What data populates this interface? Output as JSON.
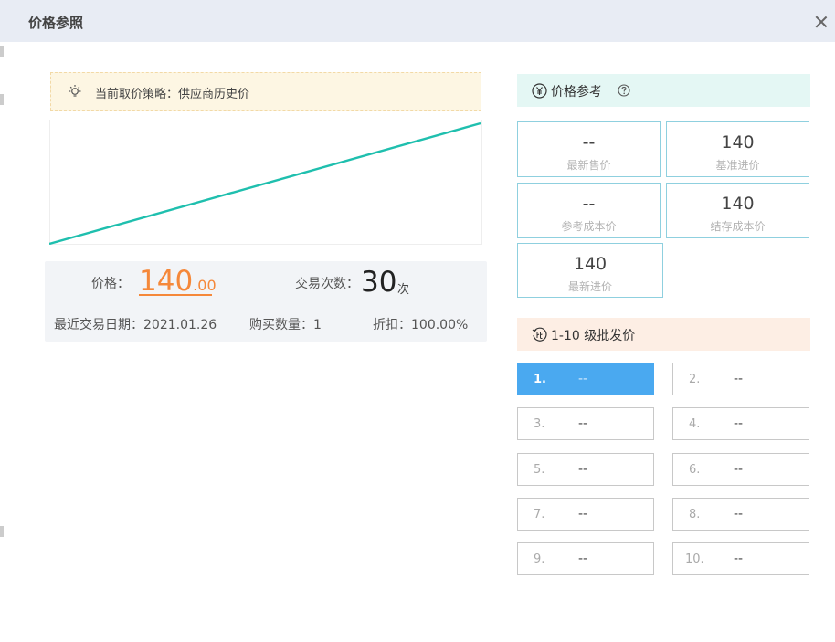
{
  "modal": {
    "title": "价格参照"
  },
  "strategy": {
    "text": "当前取价策略：供应商历史价"
  },
  "price_summary": {
    "price_label": "价格：",
    "price_int": "140",
    "price_dec": ".00",
    "count_label": "交易次数：",
    "count_value": "30",
    "count_unit": "次",
    "last_date": "最近交易日期：2021.01.26",
    "qty": "购买数量：1",
    "discount": "折扣：100.00%"
  },
  "reference": {
    "title": "价格参考",
    "cards": [
      {
        "value": "--",
        "label": "最新售价"
      },
      {
        "value": "140",
        "label": "基准进价"
      },
      {
        "value": "--",
        "label": "参考成本价"
      },
      {
        "value": "140",
        "label": "结存成本价"
      },
      {
        "value": "140",
        "label": "最新进价"
      }
    ]
  },
  "wholesale": {
    "title": "1-10 级批发价",
    "tiers": [
      {
        "num": "1.",
        "value": "--"
      },
      {
        "num": "2.",
        "value": "--"
      },
      {
        "num": "3.",
        "value": "--"
      },
      {
        "num": "4.",
        "value": "--"
      },
      {
        "num": "5.",
        "value": "--"
      },
      {
        "num": "6.",
        "value": "--"
      },
      {
        "num": "7.",
        "value": "--"
      },
      {
        "num": "8.",
        "value": "--"
      },
      {
        "num": "9.",
        "value": "--"
      },
      {
        "num": "10.",
        "value": "--"
      }
    ],
    "active_index": 0
  },
  "colors": {
    "accent_teal": "#1fbfae",
    "price_orange": "#f5883a",
    "tier_active": "#4aa9f0"
  },
  "trend": {
    "start": 0,
    "end": 1
  }
}
